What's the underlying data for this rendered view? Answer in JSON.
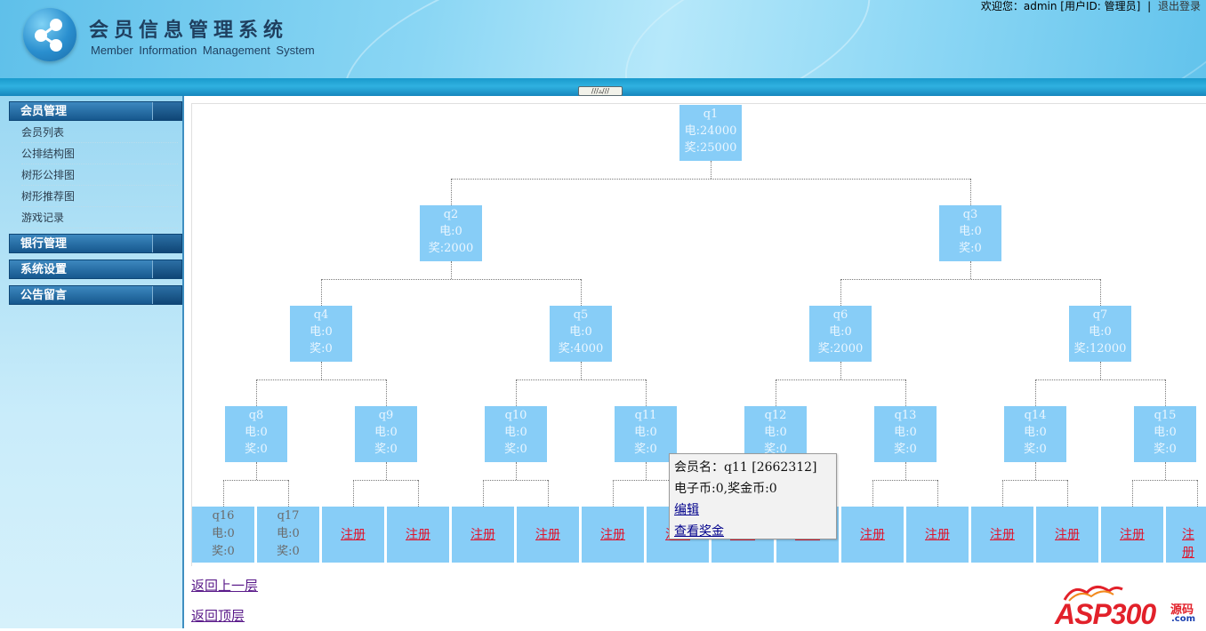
{
  "header": {
    "title": "会员信息管理系统",
    "subtitle": "Member Information Management System",
    "welcome": "欢迎您：admin [用户ID: 管理员]",
    "separator": "|",
    "logout": "退出登录",
    "collapse_icon": "collapse-up-icon"
  },
  "sidebar": {
    "groups": [
      {
        "label": "会员管理",
        "items": [
          "会员列表",
          "公排结构图",
          "树形公排图",
          "树形推荐图",
          "游戏记录"
        ]
      },
      {
        "label": "银行管理",
        "items": []
      },
      {
        "label": "系统设置",
        "items": []
      },
      {
        "label": "公告留言",
        "items": []
      }
    ]
  },
  "tree": {
    "nodes": [
      {
        "name": "q1",
        "dian": "电:24000",
        "jiang": "奖:25000"
      },
      {
        "name": "q2",
        "dian": "电:0",
        "jiang": "奖:2000"
      },
      {
        "name": "q3",
        "dian": "电:0",
        "jiang": "奖:0"
      },
      {
        "name": "q4",
        "dian": "电:0",
        "jiang": "奖:0"
      },
      {
        "name": "q5",
        "dian": "电:0",
        "jiang": "奖:4000"
      },
      {
        "name": "q6",
        "dian": "电:0",
        "jiang": "奖:2000"
      },
      {
        "name": "q7",
        "dian": "电:0",
        "jiang": "奖:12000"
      },
      {
        "name": "q8",
        "dian": "电:0",
        "jiang": "奖:0"
      },
      {
        "name": "q9",
        "dian": "电:0",
        "jiang": "奖:0"
      },
      {
        "name": "q10",
        "dian": "电:0",
        "jiang": "奖:0"
      },
      {
        "name": "q11",
        "dian": "电:0",
        "jiang": "奖:0"
      },
      {
        "name": "q12",
        "dian": "电:0",
        "jiang": "奖:0"
      },
      {
        "name": "q13",
        "dian": "电:0",
        "jiang": "奖:0"
      },
      {
        "name": "q14",
        "dian": "电:0",
        "jiang": "奖:0"
      },
      {
        "name": "q15",
        "dian": "电:0",
        "jiang": "奖:0"
      }
    ],
    "leaves": [
      {
        "name": "q16",
        "dian": "电:0",
        "jiang": "奖:0"
      },
      {
        "name": "q17",
        "dian": "电:0",
        "jiang": "奖:0"
      }
    ],
    "register_label": "注册"
  },
  "tooltip": {
    "member": "会员名：q11 [2662312]",
    "coins": "电子币:0,奖金币:0",
    "edit": "编辑",
    "view_bonus": "查看奖金"
  },
  "nav": {
    "back_one": "返回上一层",
    "back_top": "返回顶层"
  },
  "watermark": {
    "brand": "ASP300",
    "code": "源码",
    "domain": ".com"
  },
  "colors": {
    "node_bg": "#87cdf7",
    "register_link": "#e0142b",
    "menu_head": "#16588e"
  }
}
